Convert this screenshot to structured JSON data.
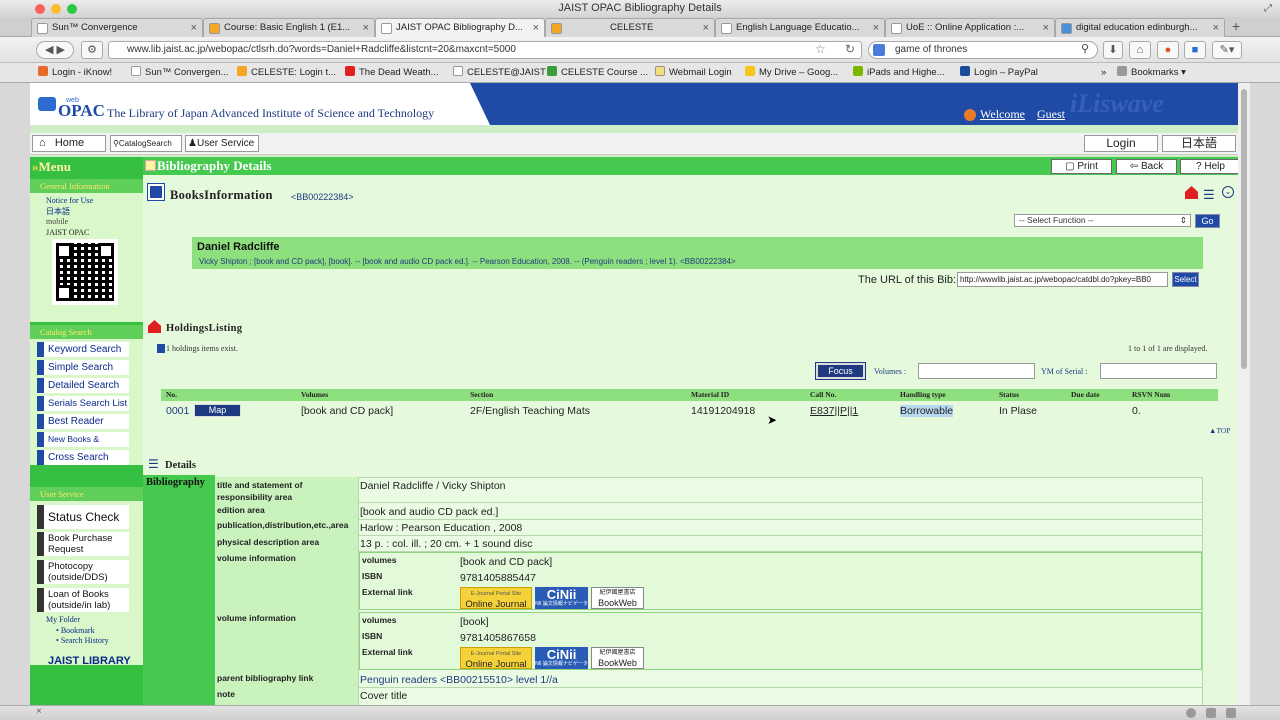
{
  "window": {
    "title": "JAIST OPAC Bibliography Details"
  },
  "tabs": [
    {
      "label": "Sun™ Convergence"
    },
    {
      "label": "Course: Basic English 1 (E1..."
    },
    {
      "label": "JAIST OPAC Bibliography D..."
    },
    {
      "label": "CELESTE"
    },
    {
      "label": "English Language Educatio..."
    },
    {
      "label": "UoE :: Online Application :..."
    },
    {
      "label": "digital education edinburgh..."
    }
  ],
  "nav": {
    "url": "www.lib.jaist.ac.jp/webopac/ctlsrh.do?words=Daniel+Radcliffe&listcnt=20&maxcnt=5000",
    "search": "game of thrones"
  },
  "bookmarks": [
    {
      "label": "Login - iKnow!"
    },
    {
      "label": "Sun™ Convergen..."
    },
    {
      "label": "CELESTE: Login t..."
    },
    {
      "label": "The Dead Weath..."
    },
    {
      "label": "CELESTE@JAIST"
    },
    {
      "label": "CELESTE Course ..."
    },
    {
      "label": "Webmail Login"
    },
    {
      "label": "My Drive – Goog..."
    },
    {
      "label": "iPads and Highe..."
    },
    {
      "label": "Login – PayPal"
    },
    {
      "label": "Bookmarks"
    }
  ],
  "header": {
    "logo_small": "web",
    "logo": "OPAC",
    "site_title": "The Library of Japan Advanced Institute of Science and Technology",
    "welcome": "Welcome",
    "guest": "Guest",
    "brand": "iLiswave"
  },
  "menubar": {
    "home": "Home",
    "catalog": "CatalogSearch",
    "user_service": "User Service",
    "login": "Login",
    "japanese": "日本語"
  },
  "left": {
    "menu": "Menu",
    "general_info": "General Information",
    "notice": "Notice for Use",
    "nihongo": "日本語",
    "mobile": "mobile",
    "jaist_opac": "JAIST OPAC",
    "catalog_search": "Catalog Search",
    "catalog_items": [
      "Keyword Search",
      "Simple Search",
      "Detailed Search",
      "Serials Search List",
      "Best Reader",
      "New Books & Journals",
      "Cross Search"
    ],
    "user_service": "User Service",
    "user_items": [
      "Status Check",
      "Book Purchase Request",
      "Photocopy (outside/DDS)",
      "Loan of Books (outside/in lab)"
    ],
    "my_folder": "My Folder",
    "bookmark": "Bookmark",
    "search_history": "Search History",
    "jaist_library": "JAIST LIBRARY"
  },
  "content": {
    "title": "Bibliography Details",
    "print": "Print",
    "back": "Back",
    "help": "Help",
    "books_info": "BooksInformation",
    "bib_id": "<BB00222384>",
    "select_function": "-- Select Function --",
    "go": "Go",
    "book_title": "Daniel Radcliffe",
    "book_desc": "Vicky Shipton ; [book and CD pack], [book]. -- [book and audio CD pack ed.]. -- Pearson Education, 2008. -- (Penguin readers ; level 1). <BB00222384>",
    "url_label": "The URL of this Bib:",
    "url_value": "http://wwwlib.jaist.ac.jp/webopac/catdbl.do?pkey=BB0",
    "select": "Select",
    "holdings": "HoldingsListing",
    "holdings_count": "1 holdings items exist.",
    "displayed": "1 to 1 of 1 are displayed.",
    "focus": "Focus",
    "volumes_label": "Volumes",
    "ym_label": "YM of Serial",
    "holdings_columns": [
      "No.",
      "Volumes",
      "Section",
      "Material ID",
      "Call No.",
      "Handling type",
      "Status",
      "Due date",
      "RSVN Num"
    ],
    "holdings_row": {
      "no": "0001",
      "map": "Map",
      "volumes": "[book and CD pack]",
      "section": "2F/English Teaching Mats",
      "material_id": "14191204918",
      "call_no": "E837||P||1",
      "handling": "Borrowable",
      "status": "In Plase",
      "due": "",
      "rsvn": "0."
    },
    "top": "TOP",
    "details": "Details",
    "bibliography": "Bibliography",
    "fields": {
      "title_label": "title and statement of responsibility area",
      "title_value": "Daniel Radcliffe / Vicky Shipton",
      "edition_label": "edition area",
      "edition_value": "[book and audio CD pack ed.]",
      "pub_label": "publication,distribution,etc.,area",
      "pub_value": "Harlow : Pearson Education , 2008",
      "phys_label": "physical description area",
      "phys_value": "13 p. : col. ill. ; 20 cm. + 1 sound disc",
      "vol_info_label": "volume information",
      "volumes_label": "volumes",
      "isbn_label": "ISBN",
      "ext_label": "External link",
      "vol1": "[book and CD pack]",
      "isbn1": "9781405885447",
      "vol2": "[book]",
      "isbn2": "9781405867658",
      "parent_label": "parent bibliography link",
      "parent_value": "Penguin readers <BB00215510> level 1//a",
      "note_label": "note",
      "note_value": "Cover title"
    },
    "ext_links": {
      "online_journal_small": "E-Journal Portal Site",
      "online_journal": "Online Journal",
      "cinii": "CiNii",
      "cinii_small": "NII 論文情報ナビゲータ",
      "bookweb_small": "紀伊國屋書店",
      "bookweb": "BookWeb"
    }
  }
}
